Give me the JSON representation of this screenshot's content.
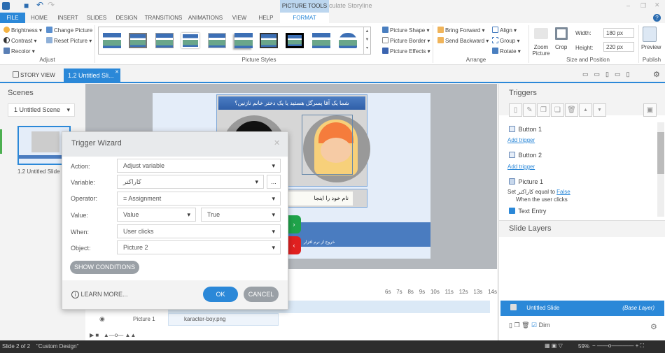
{
  "window": {
    "title": "1.story* - Articulate Storyline",
    "context_tab_group": "PICTURE TOOLS"
  },
  "menu_tabs": [
    "FILE",
    "HOME",
    "INSERT",
    "SLIDES",
    "DESIGN",
    "TRANSITIONS",
    "ANIMATIONS",
    "VIEW",
    "HELP",
    "FORMAT"
  ],
  "ribbon": {
    "adjust": {
      "label": "Adjust",
      "brightness": "Brightness",
      "contrast": "Contrast",
      "recolor": "Recolor",
      "change_picture": "Change Picture",
      "reset_picture": "Reset Picture"
    },
    "picture_styles": {
      "label": "Picture Styles",
      "picture_shape": "Picture Shape",
      "picture_border": "Picture Border",
      "picture_effects": "Picture Effects"
    },
    "arrange": {
      "label": "Arrange",
      "bring_forward": "Bring Forward",
      "send_backward": "Send Backward",
      "align": "Align",
      "group": "Group",
      "rotate": "Rotate"
    },
    "size": {
      "label": "Size and Position",
      "zoom_picture": "Zoom Picture",
      "crop": "Crop",
      "width_label": "Width:",
      "width_value": "180 px",
      "height_label": "Height:",
      "height_value": "220 px"
    },
    "publish": {
      "label": "Publish",
      "preview": "Preview"
    }
  },
  "viewbar": {
    "story_view": "STORY VIEW",
    "slide_tab": "1.2 Untitled Sli..."
  },
  "scenes": {
    "title": "Scenes",
    "selected_scene": "1 Untitled Scene",
    "slide_label": "1.2 Untitled Slide"
  },
  "slide": {
    "question": "شما یک آقا پسرگل هستید یا یک دختر خانم نازنین؟",
    "name_prompt": "نام خود را اینجا",
    "exit_text": "خروج از نرم افزار"
  },
  "dialog": {
    "title": "Trigger Wizard",
    "fields": [
      {
        "label": "Action:",
        "value": "Adjust variable"
      },
      {
        "label": "Variable:",
        "value": "کاراکتر"
      },
      {
        "label": "Operator:",
        "value": "= Assignment"
      },
      {
        "label": "Value:",
        "value": "Value",
        "value2": "True"
      },
      {
        "label": "When:",
        "value": "User clicks"
      },
      {
        "label": "Object:",
        "value": "Picture 2"
      }
    ],
    "more_button": "...",
    "show_conditions": "SHOW CONDITIONS",
    "learn_more": "LEARN MORE...",
    "ok": "OK",
    "cancel": "CANCEL"
  },
  "timeline": {
    "ticks": [
      "6s",
      "7s",
      "8s",
      "9s",
      "10s",
      "11s",
      "12s",
      "13s",
      "14s"
    ],
    "row_name": "Picture 1",
    "row_file": "karacter-boy.png"
  },
  "triggers": {
    "title": "Triggers",
    "items": [
      {
        "name": "Button 1",
        "action": "Add trigger"
      },
      {
        "name": "Button 2",
        "action": "Add trigger"
      },
      {
        "name": "Picture 1",
        "set": "Set",
        "var": "کاراکتر",
        "equal": "equal to",
        "val": "False",
        "when": "When the user clicks"
      },
      {
        "name": "Text Entry"
      }
    ]
  },
  "layers": {
    "title": "Slide Layers",
    "base_name": "Untitled Slide",
    "base_tag": "(Base Layer)",
    "dim": "Dim"
  },
  "status": {
    "slide": "Slide 2 of 2",
    "design": "\"Custom Design\"",
    "zoom": "59%"
  },
  "colors": {
    "accent": "#2b88d8",
    "ok": "#2b88d8",
    "cancel": "#9aa0a6",
    "status_bar": "#2d2d2d"
  }
}
